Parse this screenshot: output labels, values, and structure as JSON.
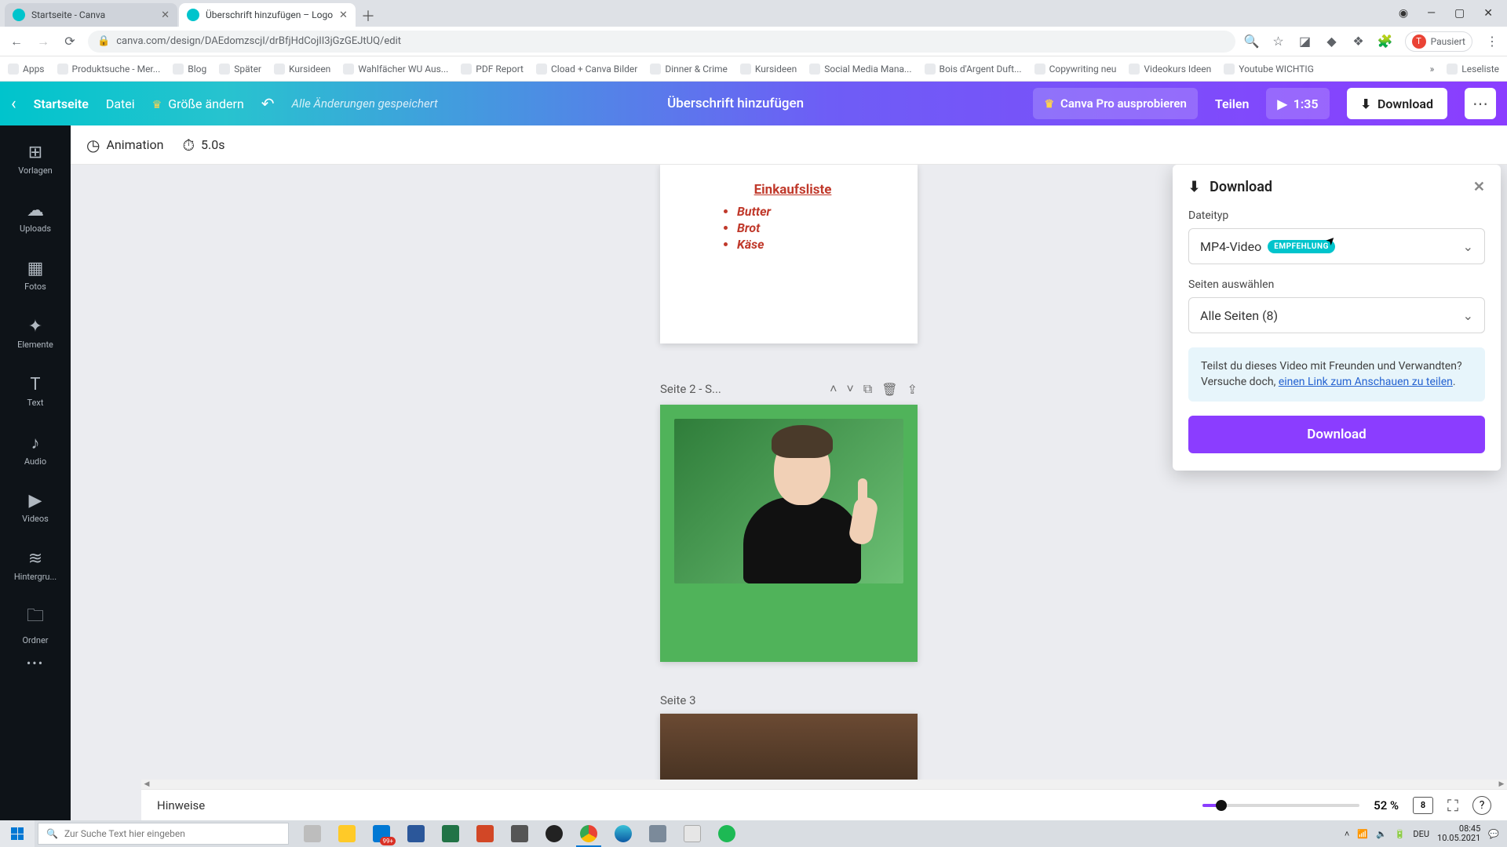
{
  "browser": {
    "tabs": [
      {
        "title": "Startseite - Canva",
        "active": false
      },
      {
        "title": "Überschrift hinzufügen – Logo",
        "active": true
      }
    ],
    "url": "canva.com/design/DAEdomzscjI/drBfjHdCojII3jGzGEJtUQ/edit",
    "profile_label": "Pausiert",
    "profile_initial": "T",
    "bookmarks": [
      "Apps",
      "Produktsuche - Mer...",
      "Blog",
      "Später",
      "Kursideen",
      "Wahlfächer WU Aus...",
      "PDF Report",
      "Cload + Canva Bilder",
      "Dinner & Crime",
      "Kursideen",
      "Social Media Mana...",
      "Bois d'Argent Duft...",
      "Copywriting neu",
      "Videokurs Ideen",
      "Youtube WICHTIG"
    ],
    "reading_list": "Leseliste"
  },
  "canva_top": {
    "home": "Startseite",
    "file": "Datei",
    "resize": "Größe ändern",
    "saved": "Alle Änderungen gespeichert",
    "doc_title": "Überschrift hinzufügen",
    "try_pro": "Canva Pro ausprobieren",
    "share": "Teilen",
    "play_time": "1:35",
    "download": "Download"
  },
  "sidebar": {
    "items": [
      {
        "label": "Vorlagen",
        "icon": "⊞"
      },
      {
        "label": "Uploads",
        "icon": "☁"
      },
      {
        "label": "Fotos",
        "icon": "▦"
      },
      {
        "label": "Elemente",
        "icon": "✦"
      },
      {
        "label": "Text",
        "icon": "T"
      },
      {
        "label": "Audio",
        "icon": "♪"
      },
      {
        "label": "Videos",
        "icon": "▶"
      },
      {
        "label": "Hintergru...",
        "icon": "≋"
      },
      {
        "label": "Ordner",
        "icon": "🗀"
      }
    ]
  },
  "toolbar": {
    "animation": "Animation",
    "duration": "5.0s"
  },
  "pages": {
    "p1": {
      "title": "Einkaufsliste",
      "items": [
        "Butter",
        "Brot",
        "Käse"
      ]
    },
    "p2": {
      "header": "Seite 2 - S..."
    },
    "p3": {
      "header": "Seite 3"
    }
  },
  "download_panel": {
    "title": "Download",
    "label_type": "Dateityp",
    "type_value": "MP4-Video",
    "type_badge": "EMPFEHLUNG",
    "label_pages": "Seiten auswählen",
    "pages_value": "Alle Seiten (8)",
    "info_text": "Teilst du dieses Video mit Freunden und Verwandten? Versuche doch, ",
    "info_link": "einen Link zum Anschauen zu teilen",
    "info_tail": ".",
    "button": "Download"
  },
  "bottom": {
    "notes": "Hinweise",
    "zoom": "52 %",
    "page_count": "8"
  },
  "taskbar": {
    "search_placeholder": "Zur Suche Text hier eingeben",
    "pin_badge": "99+",
    "lang": "DEU",
    "time": "08:45",
    "date": "10.05.2021"
  }
}
